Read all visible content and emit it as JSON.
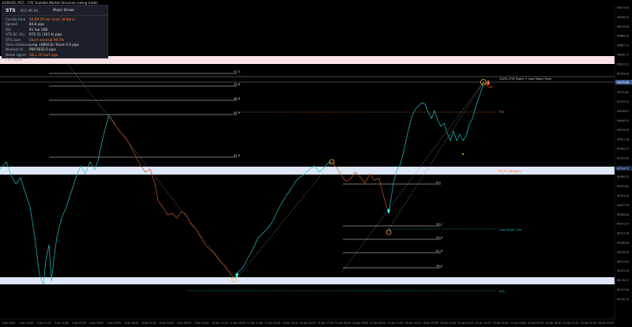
{
  "window": {
    "title": "EURUSD, M15 · OTE Scalable Market Structure (swing trade)"
  },
  "panel": {
    "symbol": "STS",
    "timeframe": "M15 M5 M1",
    "state": "Major Break",
    "rows": [
      {
        "key": "Candle time",
        "value": "00:09:26 bar (Last 18 Bars)",
        "highlight": true
      },
      {
        "key": "Spread",
        "value": "84.8 pips",
        "highlight": false
      },
      {
        "key": "Bid",
        "value": "R1 Sar 268",
        "highlight": false
      },
      {
        "key": "UTS SC (%)",
        "value": "R75 11 (107.4) pips",
        "highlight": false
      },
      {
        "key": "STS case",
        "value": "Short reversal 99.5%",
        "highlight": true
      },
      {
        "key": "Zone distance",
        "value": "Long +8850.8 / Short 0.0 pips",
        "highlight": false
      },
      {
        "key": "Nearest lvl",
        "value": "P09 6832.0 pips",
        "highlight": false
      },
      {
        "key": "Break signal",
        "value": "SELL 20 bars ago",
        "highlight": true
      },
      {
        "key": "FVG break",
        "value": "7:00",
        "highlight": false
      }
    ]
  },
  "annotations": {
    "upper_fib": [
      "97.5",
      "93.8",
      "88.6",
      "82.0",
      "78.6",
      "61.8"
    ],
    "lower_fib": [
      "0.0",
      "38.2",
      "50.0",
      "61.8",
      "78.6",
      "88.6"
    ],
    "high_label": "100% OTE Right + Last Major High",
    "poi_label": "POI",
    "zone_label": "STS PL (Broken)",
    "low_label": "Last Major Low",
    "eql_label": "EQL"
  },
  "price_labels": [
    "65973.94",
    "65948.03",
    "65919.96",
    "65889.24",
    "65867.11",
    "65840.77",
    "65812.21",
    "65784.62",
    "65759.57",
    "65732.80",
    "65703.22",
    "65676.67",
    "65648.33",
    "65619.89",
    "65591.18",
    "65563.47",
    "65535.60",
    "65508.48",
    "65480.32",
    "65452.82",
    "65424.29",
    "65397.26",
    "65369.69",
    "65341.53",
    "65314.26",
    "65286.69",
    "65258.99",
    "65231.62",
    "65203.44",
    "65176.73",
    "65147.64",
    "65120.14"
  ],
  "price_tags": {
    "current": "65970.86",
    "blue_top": "65961.90",
    "blue_mid": "65724.77",
    "blue_bottom": "65134.81"
  },
  "time_labels": [
    "2 Jan 2024",
    "2 Jan 12:00",
    "3 Jan 01:00",
    "3 Jan 14:00",
    "4 Jan 03:00",
    "4 Jan 16:00",
    "5 Jan 05:00",
    "5 Jan 18:00",
    "8 Jan 07:00",
    "8 Jan 20:00",
    "9 Jan 09:00",
    "9 Jan 22:00",
    "10 Jan 11:00",
    "11 Jan 00:00",
    "11 Jan 13:00",
    "12 Jan 02:00",
    "12 Jan 15:00",
    "15 Jan 04:00",
    "15 Jan 17:00",
    "16 Jan 06:00",
    "16 Jan 19:00",
    "17 Jan 08:00",
    "17 Jan 21:00",
    "18 Jan 10:00",
    "18 Jan 23:00",
    "19 Jan 12:00",
    "22 Jan 01:00",
    "22 Jan 14:00",
    "23 Jan 03:00",
    "23 Jan 16:00",
    "24 Jan 05:00",
    "24 Jan 18:00",
    "25 Jan 07:00",
    "25 Jan 20:00",
    "26 Jan 09:00"
  ],
  "colors": {
    "bull": "#19c6c8",
    "bear": "#c7541f",
    "zone_top": "#f9e3e6",
    "zone_blue": "#dfe8f8",
    "panel": "#1c1f27"
  }
}
